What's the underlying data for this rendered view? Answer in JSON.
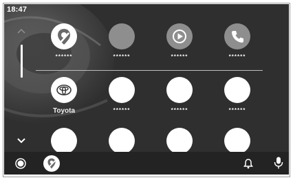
{
  "status": {
    "time": "18:47"
  },
  "apps": {
    "row1": [
      {
        "label": "******",
        "icon": "maps-icon",
        "color": "#ffffff"
      },
      {
        "label": "******",
        "icon": "blank-app-icon",
        "color": "#8e8e8e"
      },
      {
        "label": "******",
        "icon": "play-icon",
        "color": "#8e8e8e"
      },
      {
        "label": "******",
        "icon": "phone-icon",
        "color": "#8e8e8e"
      }
    ],
    "row2": [
      {
        "label": "Toyota",
        "icon": "toyota-logo-icon",
        "color": "#ffffff"
      },
      {
        "label": "******",
        "icon": "blank-app-icon",
        "color": "#ffffff"
      },
      {
        "label": "******",
        "icon": "blank-app-icon",
        "color": "#ffffff"
      },
      {
        "label": "******",
        "icon": "blank-app-icon",
        "color": "#ffffff"
      }
    ],
    "row3": [
      {
        "icon": "blank-app-icon",
        "color": "#ffffff"
      },
      {
        "icon": "blank-app-icon",
        "color": "#ffffff"
      },
      {
        "icon": "blank-app-icon",
        "color": "#ffffff"
      },
      {
        "icon": "blank-app-icon",
        "color": "#ffffff"
      }
    ]
  },
  "bottom_bar": {
    "left": [
      "home-icon",
      "maps-icon"
    ],
    "right": [
      "bell-icon",
      "microphone-icon"
    ]
  },
  "colors": {
    "screen_bg": "#2f2f2f",
    "bar_bg": "#232323",
    "accent": "#ffffff"
  }
}
